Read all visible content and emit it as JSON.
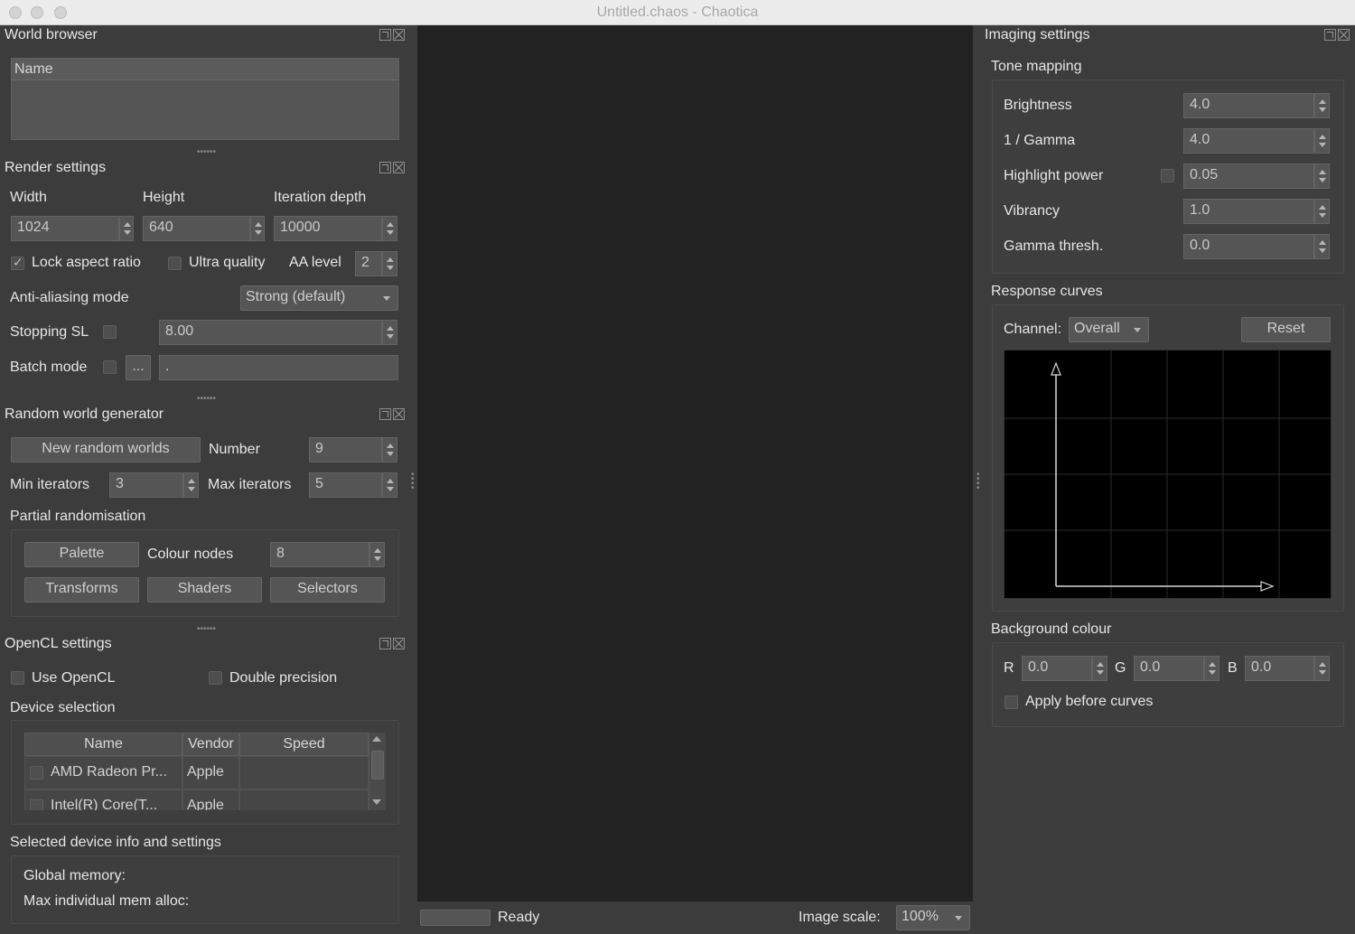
{
  "window": {
    "title": "Untitled.chaos - Chaotica"
  },
  "world_browser": {
    "title": "World browser",
    "column_header": "Name"
  },
  "render_settings": {
    "title": "Render settings",
    "width_label": "Width",
    "height_label": "Height",
    "iteration_label": "Iteration depth",
    "width_value": "1024",
    "height_value": "640",
    "iteration_value": "10000",
    "lock_aspect_label": "Lock aspect ratio",
    "lock_aspect_checked": true,
    "ultra_quality_label": "Ultra quality",
    "aa_level_label": "AA level",
    "aa_level_value": "2",
    "aa_mode_label": "Anti-aliasing mode",
    "aa_mode_value": "Strong (default)",
    "stopping_sl_label": "Stopping SL",
    "stopping_sl_value": "8.00",
    "batch_mode_label": "Batch mode",
    "browse_label": "...",
    "batch_path_value": "."
  },
  "random_world": {
    "title": "Random world generator",
    "new_button": "New random worlds",
    "number_label": "Number",
    "number_value": "9",
    "min_label": "Min iterators",
    "min_value": "3",
    "max_label": "Max iterators",
    "max_value": "5",
    "partial_label": "Partial randomisation",
    "palette_button": "Palette",
    "colour_nodes_label": "Colour nodes",
    "colour_nodes_value": "8",
    "transforms_button": "Transforms",
    "shaders_button": "Shaders",
    "selectors_button": "Selectors"
  },
  "opencl": {
    "title": "OpenCL settings",
    "use_label": "Use OpenCL",
    "double_label": "Double precision",
    "device_selection_label": "Device selection",
    "columns": [
      "Name",
      "Vendor",
      "Speed"
    ],
    "rows": [
      {
        "name": "AMD Radeon Pr...",
        "vendor": "Apple",
        "speed": ""
      },
      {
        "name": "Intel(R) Core(T...",
        "vendor": "Apple",
        "speed": ""
      }
    ],
    "device_info_label": "Selected device info and settings",
    "global_memory_label": "Global memory:",
    "max_alloc_label": "Max individual mem alloc:"
  },
  "status": {
    "text": "Ready",
    "image_scale_label": "Image scale:",
    "image_scale_value": "100%"
  },
  "imaging": {
    "title": "Imaging settings",
    "tone_mapping_label": "Tone mapping",
    "brightness_label": "Brightness",
    "brightness_value": "4.0",
    "gamma_label": "1 / Gamma",
    "gamma_value": "4.0",
    "highlight_label": "Highlight power",
    "highlight_value": "0.05",
    "vibrancy_label": "Vibrancy",
    "vibrancy_value": "1.0",
    "gamma_thresh_label": "Gamma thresh.",
    "gamma_thresh_value": "0.0",
    "response_curves_label": "Response curves",
    "channel_label": "Channel:",
    "channel_value": "Overall",
    "reset_button": "Reset",
    "background_label": "Background colour",
    "r_label": "R",
    "r_value": "0.0",
    "g_label": "G",
    "g_value": "0.0",
    "b_label": "B",
    "b_value": "0.0",
    "apply_before_label": "Apply before curves"
  }
}
